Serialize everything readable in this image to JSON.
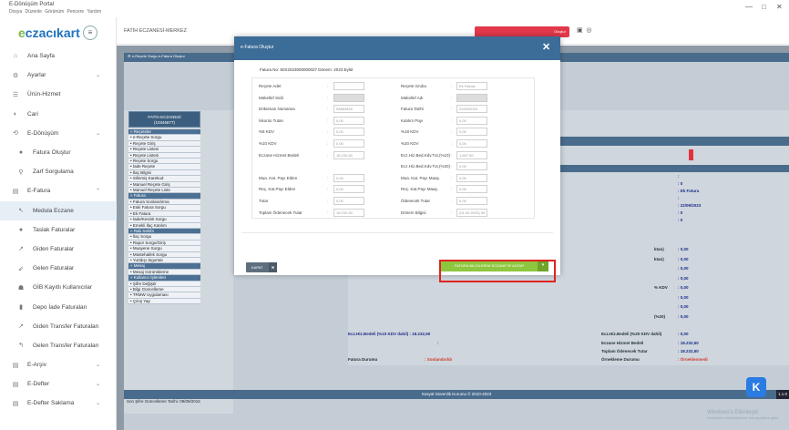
{
  "window": {
    "title": "E-Dönüşüm Portal",
    "menu": [
      "Dosya",
      "Düzenle",
      "Görünüm",
      "Pencere",
      "Yardım"
    ],
    "controls": [
      "—",
      "□",
      "✕"
    ]
  },
  "brand": {
    "logo_pre": "e",
    "logo_rest": "czacıkart"
  },
  "sidebar": {
    "items": [
      {
        "label": "Ana Sayfa",
        "icon": "home-icon",
        "glyph": "⌂",
        "chev": ""
      },
      {
        "label": "Ayarlar",
        "icon": "gear-icon",
        "glyph": "⚙",
        "chev": "⌄"
      },
      {
        "label": "Ürün-Hizmet",
        "icon": "list-icon",
        "glyph": "☰",
        "chev": ""
      },
      {
        "label": "Cari",
        "icon": "contact-icon",
        "glyph": "◐",
        "chev": ""
      },
      {
        "label": "E-Dönüşüm",
        "icon": "sync-icon",
        "glyph": "⟲",
        "chev": "⌄"
      },
      {
        "label": "Fatura Oluştur",
        "icon": "invoice-icon",
        "glyph": "●",
        "chev": ""
      },
      {
        "label": "Zarf Sorgulama",
        "icon": "search-icon",
        "glyph": "⚲",
        "chev": ""
      },
      {
        "label": "E-Fatura",
        "icon": "efatura-icon",
        "glyph": "▤",
        "chev": "⌃"
      },
      {
        "label": "Medula Eczane",
        "icon": "arrow-icon",
        "glyph": "↖",
        "chev": ""
      },
      {
        "label": "Taslak Faturalar",
        "icon": "draft-icon",
        "glyph": "●",
        "chev": ""
      },
      {
        "label": "Giden Faturalar",
        "icon": "outgoing-icon",
        "glyph": "↗",
        "chev": ""
      },
      {
        "label": "Gelen Faturalar",
        "icon": "incoming-icon",
        "glyph": "⇙",
        "chev": ""
      },
      {
        "label": "GİB Kayıtlı Kullanıcılar",
        "icon": "users-icon",
        "glyph": "☗",
        "chev": ""
      },
      {
        "label": "Depo İade Faturaları",
        "icon": "warehouse-icon",
        "glyph": "▮",
        "chev": ""
      },
      {
        "label": "Giden Transfer Faturaları",
        "icon": "transfer-out-icon",
        "glyph": "↗",
        "chev": ""
      },
      {
        "label": "Gelen Transfer Faturaları",
        "icon": "transfer-in-icon",
        "glyph": "↰",
        "chev": ""
      },
      {
        "label": "E-Arşiv",
        "icon": "archive-icon",
        "glyph": "▤",
        "chev": "⌄"
      },
      {
        "label": "E-Defter",
        "icon": "ledger-icon",
        "glyph": "▤",
        "chev": "⌄"
      },
      {
        "label": "E-Defter Saklama",
        "icon": "storage-icon",
        "glyph": "▤",
        "chev": "⌄"
      }
    ]
  },
  "topbar": {
    "pharmacy": "FATİH ECZANESİ-MERKEZ",
    "red_button": "Oluştur"
  },
  "portal": {
    "tabs": "⚙  e-Reçete Sorgu   e-Fatura Oluştur",
    "left_title_line1": "FATİH ECZANESİ",
    "left_title_line2": "(10345677)",
    "menu": [
      {
        "t": "Reçeteler",
        "h": true
      },
      {
        "t": "e-Reçete Sorgu"
      },
      {
        "t": "Reçete Giriş"
      },
      {
        "t": "Reçete Listesi"
      },
      {
        "t": "Reçete Listesi"
      },
      {
        "t": "Reçete Sorgu"
      },
      {
        "t": "İade Reçete"
      },
      {
        "t": "İlaç Bilgisi"
      },
      {
        "t": "Silinmiş Karekod"
      },
      {
        "t": "Manuel Reçete Giriş"
      },
      {
        "t": "Manuel Reçete Liste"
      },
      {
        "t": "Fatura",
        "h": true
      },
      {
        "t": "Fatura Sonlandırma"
      },
      {
        "t": "Eski Fatura Sorgu"
      },
      {
        "t": "Ek Fatura"
      },
      {
        "t": "İade/Kesinti Sorgu"
      },
      {
        "t": "Emekli İlaç Katılım"
      },
      {
        "t": "Rab Sahibi",
        "h": true
      },
      {
        "t": "İlaç Sorgu"
      },
      {
        "t": "Rapor Sorgu/Giriş"
      },
      {
        "t": "Muayene Sorgu"
      },
      {
        "t": "Müstehaklık Sorgu"
      },
      {
        "t": "Yurtdışı Sigortalı"
      },
      {
        "t": "Mesaj",
        "h": true
      },
      {
        "t": "Mesaj Görüntüleme"
      },
      {
        "t": "Kullanıcı İşlemleri",
        "h": true
      },
      {
        "t": "Şifre Değiştir"
      },
      {
        "t": "Bilgi Güncelleme"
      },
      {
        "t": "TRMW Uygulaması"
      },
      {
        "t": "Çıkış Yap"
      }
    ],
    "last_date": "Son Şifre Güncelleme Tarihi: 09/09/2016",
    "footer": "Sosyal Güvenlik Kurumu © 2010-2023",
    "footer_right": "1.1.0"
  },
  "details": {
    "right": [
      {
        "k": "ktan)",
        "v": ": 0,00"
      },
      {
        "k": "ktan)",
        "v": ": 0,00"
      },
      {
        "k": "",
        "v": ": 0,00"
      },
      {
        "k": "",
        "v": ": 0,00"
      },
      {
        "k": "% KDV",
        "v": ": 0,00"
      },
      {
        "k": "",
        "v": ": 0,00"
      },
      {
        "k": "",
        "v": ": 0,00"
      },
      {
        "k": "(%20)",
        "v": ": 0,00"
      }
    ],
    "top_values": [
      ":",
      ": 0",
      ": Ek Fatura",
      ":",
      ": 22/09/2023",
      ": 0",
      ": 0"
    ],
    "ecz_left": "Ecz.Hiz.Bedeli (%10 KDV dahil) : 18.232,50",
    "ecz_right_k": "Ecz.Hiz.Bedeli (%20 KDV dahil)",
    "ecz_right_v": ": 0,00",
    "r1k": "Eczane Hizmet Bedeli",
    "r1v": ": 18.232,50",
    "r2k": "Toplam Ödenecek Tutar",
    "r2v": ": 18.232,50",
    "fd_k": "Fatura Durumu",
    "fd_v": ": Sonlandırıldı",
    "on_k": "Örnekleme Durumu",
    "on_v": ": Örneklenmedi",
    "colon_mid": ":"
  },
  "modal": {
    "title": "e-Fatura Oluştur",
    "close": "✕",
    "invoice_no": "Fatura No: 50X2023000000027 Dönem: 2023 Eylül",
    "fields": [
      {
        "l": "Reçete Adet",
        "v": "",
        "r": "Reçete Grubu",
        "rv": "Ek Fatura"
      },
      {
        "l": "Mükellef Sicili",
        "v": "",
        "r": "Mükellef Adı",
        "rv": "",
        "gray": true
      },
      {
        "l": "Döküman Numarası",
        "v": "53663645",
        "r": "Fatura Tarihi",
        "rv": "22/09/2023"
      },
      {
        "l": "İskonto Tutarı",
        "v": "0,00",
        "r": "Katılım Payı",
        "rv": "0,00"
      },
      {
        "l": "%8 KDV",
        "v": "0,00",
        "r": "%18 KDV",
        "rv": "0,00"
      },
      {
        "l": "%10 KDV",
        "v": "0,00",
        "r": "%20 KDV",
        "rv": "0,00"
      },
      {
        "l": "Eczane Hizmet Bedeli",
        "v": "18.232,50",
        "r": "Ecz.Hiz.Bed.Kdv.Tut.(%10)",
        "rv": "1.657,50"
      },
      {
        "l": "",
        "v": "",
        "r": "Ecz.Hiz.Bed.Kdv.Tut.(%20)",
        "rv": "0,00"
      },
      {
        "l": "Mua. Kat. Payı Elden",
        "v": "0,00",
        "r": "Mua. Kat. Payı Maaş.",
        "rv": "0,00"
      },
      {
        "l": "Reç. Kat.Payı Elden",
        "v": "0,00",
        "r": "Reç. Kat.Payı Maaş.",
        "rv": "0,00"
      },
      {
        "l": "Tutar",
        "v": "0,00",
        "r": "Ödenecek Tutar",
        "rv": "0,00"
      },
      {
        "l": "Toplam Ödenecek Tutar",
        "v": "18.232,50",
        "r": "Dönem Bilgisi",
        "rv": "(01.09.2023) 09"
      }
    ],
    "close_button": "KAPAT",
    "close_x": "✖",
    "submit_button": "FATURA BİLGİLERİNİ ECZANEYE AKTAR",
    "submit_dd": "▾"
  },
  "watermark": {
    "line1": "Windows'u Etkinleştir",
    "line2": "Windows'u etkinleştirmek için Ayarlar'a gidin."
  },
  "colors": {
    "header_blue": "#3c6c98",
    "accent_red": "#e2384a",
    "green": "#8dc63f",
    "highlight": "#e0231e"
  }
}
